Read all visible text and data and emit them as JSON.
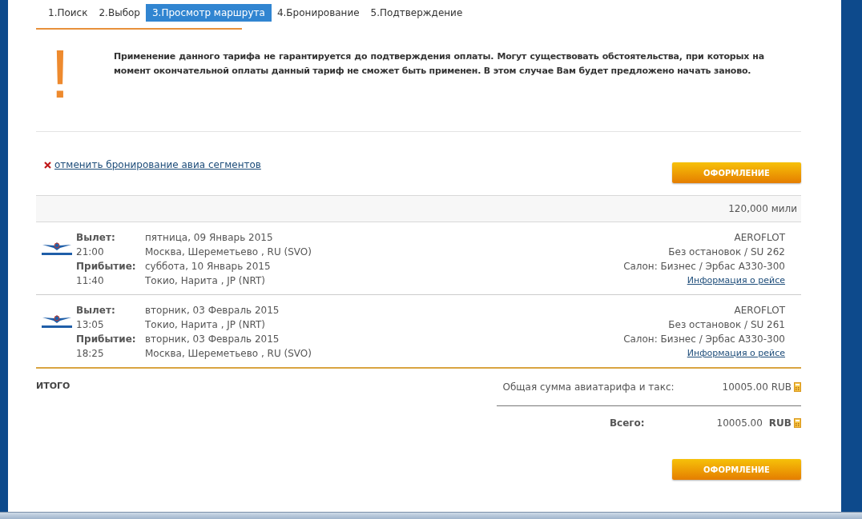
{
  "steps": [
    {
      "label": "1.Поиск",
      "selected": false
    },
    {
      "label": "2.Выбор",
      "selected": false
    },
    {
      "label": "3.Просмотр маршрута",
      "selected": true
    },
    {
      "label": "4.Бронирование",
      "selected": false
    },
    {
      "label": "5.Подтверждение",
      "selected": false
    }
  ],
  "warning": {
    "mark": "!",
    "text": "Применение данного тарифа не гарантируется до подтверждения оплаты. Могут существовать обстоятельства, при которых на момент окончательной оплаты данный тариф не сможет быть применен. В этом случае Вам будет предложено начать заново."
  },
  "cancel_link": "отменить бронирование авиа сегментов",
  "checkout_button_top": "ОФОРМЛЕНИЕ",
  "miles": "120,000 мили",
  "segments": [
    {
      "departure": {
        "label": "Вылет:",
        "time": "21:00",
        "date": "пятница, 09 Январь 2015",
        "place": "Москва, Шереметьево , RU (SVO)"
      },
      "arrival": {
        "label": "Прибытие:",
        "time": "11:40",
        "date": "суббота, 10 Январь 2015",
        "place": "Токио, Нарита , JP (NRT)"
      },
      "airline": "AEROFLOT",
      "stops": "Без остановок / SU 262",
      "cabin": "Салон: Бизнес / Эрбас А330-300",
      "info_link": "Информация о рейсе"
    },
    {
      "departure": {
        "label": "Вылет:",
        "time": "13:05",
        "date": "вторник, 03 Февраль 2015",
        "place": "Токио, Нарита , JP (NRT)"
      },
      "arrival": {
        "label": "Прибытие:",
        "time": "18:25",
        "date": "вторник, 03 Февраль 2015",
        "place": "Москва, Шереметьево , RU (SVO)"
      },
      "airline": "AEROFLOT",
      "stops": "Без остановок / SU 261",
      "cabin": "Салон: Бизнес / Эрбас А330-300",
      "info_link": "Информация о рейсе"
    }
  ],
  "totals": {
    "title": "ИТОГО",
    "fare_label": "Общая сумма авиатарифа и такс:",
    "fare_value": "10005.00 RUB",
    "grand_label": "Всего:",
    "grand_amount": "10005.00",
    "grand_currency": "RUB"
  },
  "checkout_button_bottom": "ОФОРМЛЕНИЕ"
}
